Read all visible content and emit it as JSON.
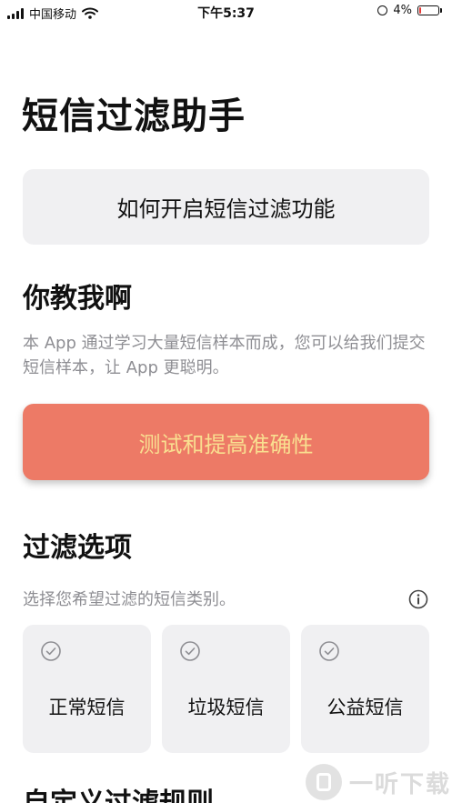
{
  "status_bar": {
    "carrier": "中国移动",
    "time": "下午5:37",
    "battery_percent": "4%",
    "battery_level": 0.04,
    "battery_color": "#e53935"
  },
  "page": {
    "title": "短信过滤助手"
  },
  "how_to_enable": {
    "label": "如何开启短信过滤功能"
  },
  "teach_section": {
    "heading": "你教我啊",
    "description": "本 App 通过学习大量短信样本而成，您可以给我们提交短信样本，让 App 更聪明。",
    "button_label": "测试和提高准确性",
    "button_color": "#ed7a66",
    "button_text_color": "#f9df90"
  },
  "filter_section": {
    "heading": "过滤选项",
    "description": "选择您希望过滤的短信类别。",
    "options": [
      {
        "label": "正常短信",
        "icon": "check-circle-icon"
      },
      {
        "label": "垃圾短信",
        "icon": "check-circle-icon"
      },
      {
        "label": "公益短信",
        "icon": "check-circle-icon"
      }
    ]
  },
  "custom_section": {
    "heading": "自定义过滤规则"
  },
  "watermark": {
    "text": "一听下载"
  }
}
